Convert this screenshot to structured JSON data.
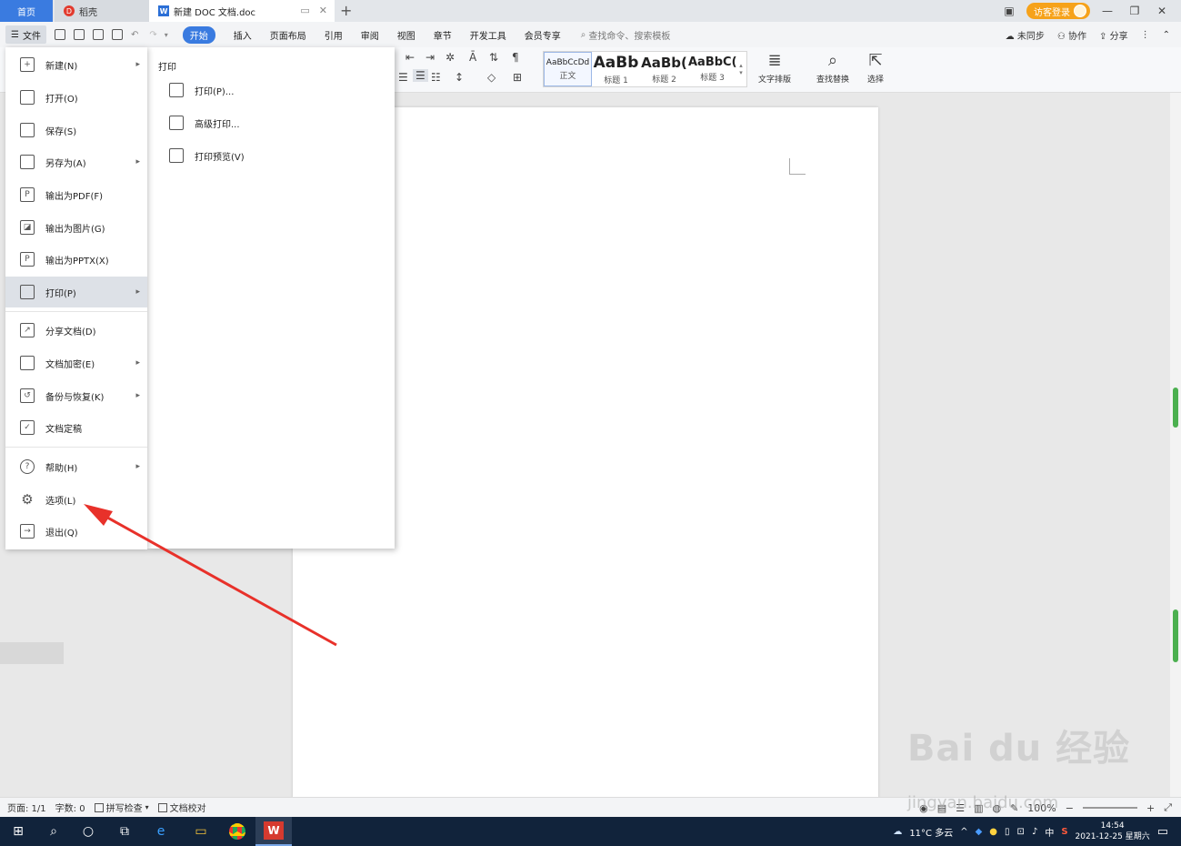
{
  "tabs": {
    "home": "首页",
    "docer": "稻壳",
    "document": "新建 DOC 文档.doc"
  },
  "title_right": {
    "guest_login": "访客登录"
  },
  "menubar": {
    "file": "文件",
    "tabs": [
      "开始",
      "插入",
      "页面布局",
      "引用",
      "审阅",
      "视图",
      "章节",
      "开发工具",
      "会员专享"
    ],
    "search_placeholder": "查找命令、搜索模板",
    "unsynced": "未同步",
    "collaborate": "协作",
    "share": "分享"
  },
  "ribbon": {
    "styles": [
      {
        "sample": "AaBbCcDd",
        "label": "正文"
      },
      {
        "sample": "AaBb",
        "label": "标题 1"
      },
      {
        "sample": "AaBb(",
        "label": "标题 2"
      },
      {
        "sample": "AaBbC(",
        "label": "标题 3"
      }
    ],
    "text_layout": "文字排版",
    "find_replace": "查找替换",
    "select": "选择"
  },
  "file_menu": {
    "items": [
      {
        "label": "新建(N)",
        "icon": "new-icon",
        "has_sub": true
      },
      {
        "label": "打开(O)",
        "icon": "folder-open-icon",
        "has_sub": false
      },
      {
        "label": "保存(S)",
        "icon": "save-icon",
        "has_sub": false
      },
      {
        "label": "另存为(A)",
        "icon": "save-as-icon",
        "has_sub": true
      },
      {
        "label": "输出为PDF(F)",
        "icon": "pdf-icon",
        "has_sub": false
      },
      {
        "label": "输出为图片(G)",
        "icon": "image-icon",
        "has_sub": false
      },
      {
        "label": "输出为PPTX(X)",
        "icon": "pptx-icon",
        "has_sub": false
      },
      {
        "label": "打印(P)",
        "icon": "printer-icon",
        "has_sub": true
      },
      {
        "label": "分享文档(D)",
        "icon": "share-icon",
        "has_sub": false
      },
      {
        "label": "文档加密(E)",
        "icon": "lock-doc-icon",
        "has_sub": true
      },
      {
        "label": "备份与恢复(K)",
        "icon": "backup-icon",
        "has_sub": true
      },
      {
        "label": "文档定稿",
        "icon": "finalize-icon",
        "has_sub": false
      },
      {
        "label": "帮助(H)",
        "icon": "help-icon",
        "has_sub": true
      },
      {
        "label": "选项(L)",
        "icon": "gear-icon",
        "has_sub": false
      },
      {
        "label": "退出(Q)",
        "icon": "exit-icon",
        "has_sub": false
      }
    ]
  },
  "print_submenu": {
    "title": "打印",
    "items": [
      "打印(P)...",
      "高级打印...",
      "打印预览(V)"
    ]
  },
  "statusbar": {
    "page": "页面: 1/1",
    "words": "字数: 0",
    "spell_check": "拼写检查",
    "proofread": "文档校对",
    "zoom": "100%"
  },
  "taskbar": {
    "weather": "11°C 多云",
    "ime": "中",
    "time": "14:54",
    "date": "2021-12-25 星期六"
  },
  "watermark": {
    "main": "Bai du 经验",
    "url": "jingyan.baidu.com"
  },
  "colors": {
    "accent": "#3a7be0",
    "annotation_arrow": "#e8312a"
  }
}
